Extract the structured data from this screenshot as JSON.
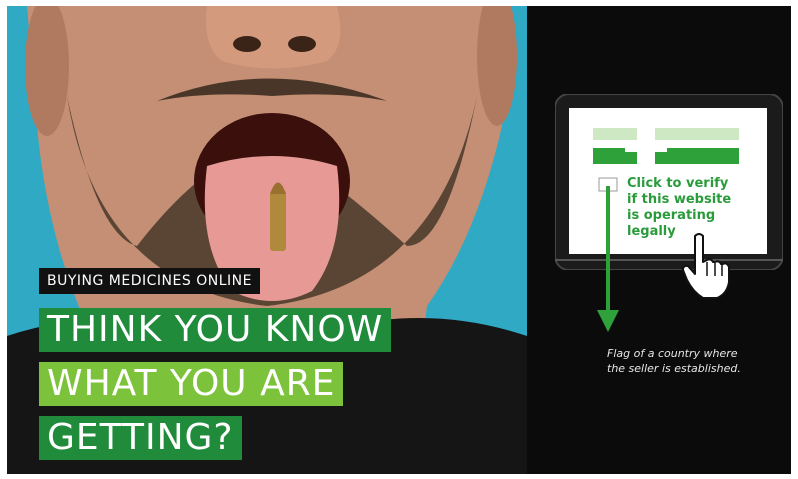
{
  "banner": {
    "tag": "BUYING MEDICINES ONLINE",
    "headline_lines": [
      "THINK YOU KNOW",
      "WHAT YOU ARE",
      "GETTING?"
    ]
  },
  "tablet": {
    "verify_lines": [
      "Click to verify",
      "if this website",
      "is operating",
      "legally"
    ]
  },
  "caption_lines": [
    "Flag of a country where",
    "the seller is established."
  ],
  "colors": {
    "green_dark": "#1f8b3b",
    "green_light": "#7cc23a",
    "teal_background": "#2fa9c4",
    "panel_black": "#0b0b0b"
  }
}
